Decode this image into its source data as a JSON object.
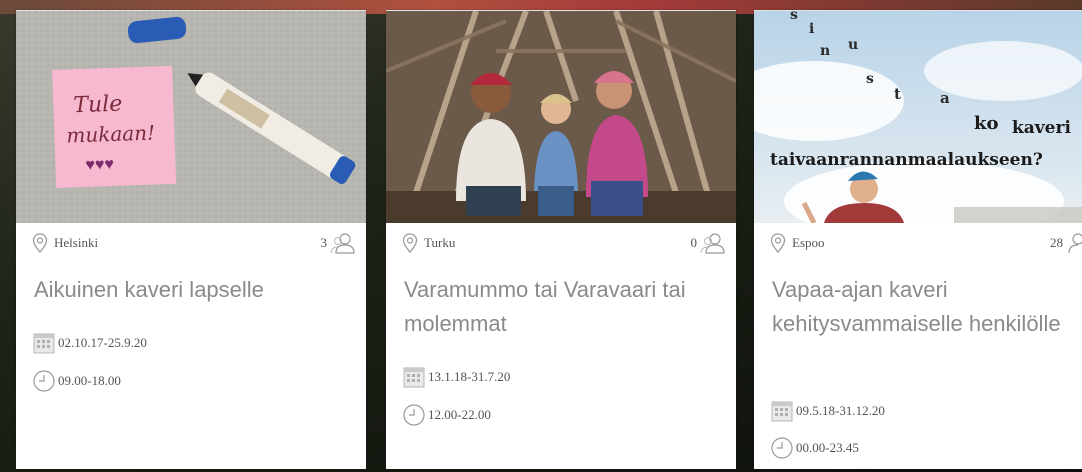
{
  "cards": [
    {
      "location": "Helsinki",
      "participants": "3",
      "title": "Aikuinen kaveri lapselle",
      "date_range": "02.10.17-25.9.20",
      "time_range": "09.00-18.00",
      "image": {
        "note_line_1": "Tule",
        "note_line_2": "mukaan!",
        "note_hearts": "♥♥♥",
        "note_color": "#f7b9cf",
        "pen_color": "#2a5bb5"
      }
    },
    {
      "location": "Turku",
      "participants": "0",
      "title": "Varamummo tai Varavaari tai molemmat",
      "date_range": "13.1.18-31.7.20",
      "time_range": "12.00-22.00"
    },
    {
      "location": "Espoo",
      "participants": "28",
      "title": "Vapaa-ajan kaveri kehitysvammaiselle henkilölle",
      "date_range": "09.5.18-31.12.20",
      "time_range": "00.00-23.45",
      "image": {
        "sky_letters": [
          "s",
          "i",
          "n",
          "u",
          "s",
          "t",
          "a"
        ],
        "sky_word_1": "ko",
        "sky_word_2": "kaveri",
        "sky_line_2": "taivaanrannanmaalaukseen?"
      }
    }
  ],
  "colors": {
    "title_text": "#8a8a8a",
    "meta_text": "#555555",
    "icon_stroke": "#999999",
    "card_bg": "#ffffff"
  },
  "icons": {
    "location": "location-pin-icon",
    "participants": "users-icon",
    "date": "calendar-icon",
    "time": "clock-icon"
  }
}
